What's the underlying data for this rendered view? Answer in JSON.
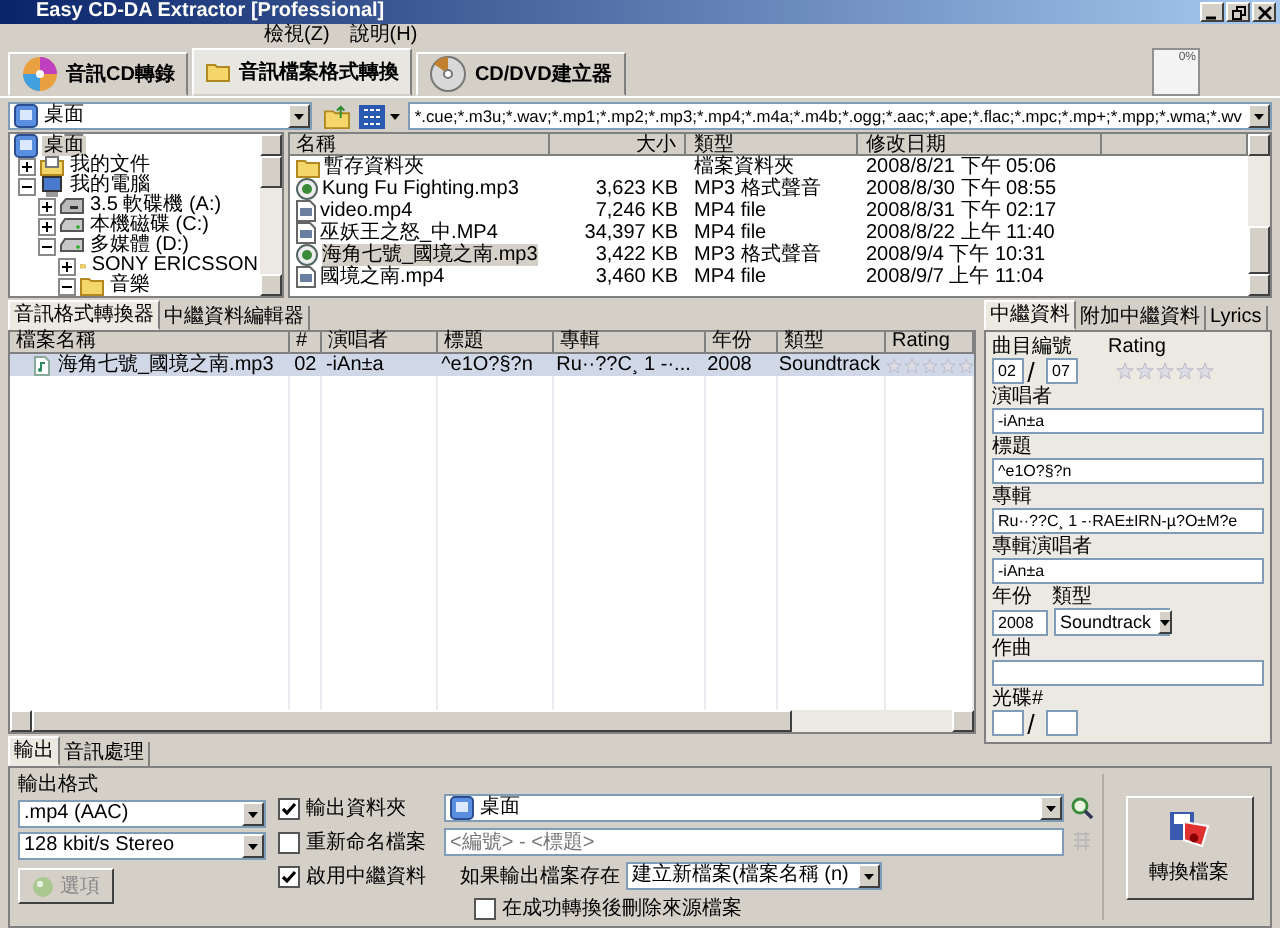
{
  "window": {
    "title": "Easy CD-DA Extractor [Professional]"
  },
  "menu": [
    "檢視(Z)",
    "說明(H)"
  ],
  "main_tabs": [
    {
      "label": "音訊CD轉錄",
      "kind": "cd",
      "selected": false
    },
    {
      "label": "音訊檔案格式轉換",
      "kind": "folder",
      "selected": true
    },
    {
      "label": "CD/DVD建立器",
      "kind": "burn",
      "selected": false
    }
  ],
  "progress": {
    "reading": "0%"
  },
  "location": {
    "value": "桌面"
  },
  "filter": {
    "value": "*.cue;*.m3u;*.wav;*.mp1;*.mp2;*.mp3;*.mp4;*.m4a;*.m4b;*.ogg;*.aac;*.ape;*.flac;*.mpc;*.mp+;*.mpp;*.wma;*.wv"
  },
  "tree_root": {
    "label": "桌面",
    "selected": true
  },
  "folder_tree": [
    {
      "label": "我的文件",
      "kind": "documents",
      "expanded": false,
      "selected": false
    },
    {
      "label": "我的電腦",
      "kind": "computer",
      "expanded": true,
      "selected": false,
      "children": [
        {
          "label": "3.5 軟碟機 (A:)",
          "kind": "floppy",
          "expanded": false,
          "selected": false
        },
        {
          "label": "本機磁碟 (C:)",
          "kind": "drive",
          "expanded": false,
          "selected": false
        },
        {
          "label": "多媒體 (D:)",
          "kind": "drive",
          "expanded": true,
          "selected": false,
          "children": [
            {
              "label": "SONY ERICSSON",
              "kind": "folder",
              "expanded": false,
              "selected": false
            },
            {
              "label": "音樂",
              "kind": "folder",
              "expanded": true,
              "selected": false
            }
          ]
        }
      ]
    }
  ],
  "file_list": {
    "columns": [
      "名稱",
      "大小",
      "類型",
      "修改日期"
    ],
    "rows": [
      {
        "name": "暫存資料夾",
        "type": "檔案資料夾",
        "modified": "2008/8/21 下午 05:06",
        "kind": "folder",
        "selected": false
      },
      {
        "name": "Kung Fu Fighting.mp3",
        "size": "3,623 KB",
        "type": "MP3 格式聲音",
        "modified": "2008/8/30 下午 08:55",
        "kind": "audio",
        "selected": false
      },
      {
        "name": "video.mp4",
        "size": "7,246 KB",
        "type": "MP4 file",
        "modified": "2008/8/31 下午 02:17",
        "kind": "video",
        "selected": false
      },
      {
        "name": "巫妖王之怒_中.MP4",
        "size": "34,397 KB",
        "type": "MP4 file",
        "modified": "2008/8/22 上午 11:40",
        "kind": "video",
        "selected": false
      },
      {
        "name": "海角七號_國境之南.mp3",
        "size": "3,422 KB",
        "type": "MP3 格式聲音",
        "modified": "2008/9/4 下午 10:31",
        "kind": "audio",
        "selected": true
      },
      {
        "name": "國境之南.mp4",
        "size": "3,460 KB",
        "type": "MP4 file",
        "modified": "2008/9/7 上午 11:04",
        "kind": "video",
        "selected": false
      }
    ]
  },
  "converter_tabs": [
    {
      "label": "音訊格式轉換器",
      "selected": true
    },
    {
      "label": "中繼資料編輯器",
      "selected": false
    }
  ],
  "queue": {
    "columns": [
      "檔案名稱",
      "#",
      "演唱者",
      "標題",
      "專輯",
      "年份",
      "類型",
      "Rating"
    ],
    "rows": [
      {
        "file": "海角七號_國境之南.mp3",
        "track": "02",
        "artist": "-iAn±a",
        "title": "^e1O?§?n",
        "album": "Ru··??C¸ 1 -·...",
        "year": "2008",
        "genre": "Soundtrack",
        "stars": 0,
        "selected": true
      }
    ]
  },
  "tag_tabs": [
    {
      "label": "中繼資料",
      "selected": true
    },
    {
      "label": "附加中繼資料",
      "selected": false
    },
    {
      "label": "Lyrics",
      "selected": false
    }
  ],
  "tags": {
    "track_label": "曲目編號",
    "track": "02",
    "track_total": "07",
    "rating_label": "Rating",
    "stars": 0,
    "fields": [
      {
        "label": "演唱者",
        "value": "-iAn±a"
      },
      {
        "label": "標題",
        "value": "^e1O?§?n"
      },
      {
        "label": "專輯",
        "value": "Ru··??C¸ 1 -·RAE±IRN-µ?O±M?e"
      },
      {
        "label": "專輯演唱者",
        "value": "-iAn±a"
      }
    ],
    "year_label": "年份",
    "year": "2008",
    "genre_label": "類型",
    "genre": "Soundtrack",
    "composer_label": "作曲",
    "disc_label": "光碟#"
  },
  "output_tabs": [
    {
      "label": "輸出",
      "selected": true
    },
    {
      "label": "音訊處理",
      "selected": false
    }
  ],
  "output": {
    "format_label": "輸出格式",
    "format": ".mp4 (AAC)",
    "quality": "128 kbit/s Stereo",
    "options_button": {
      "label": "選項",
      "disabled": true
    },
    "output_folder": {
      "label": "輸出資料夾",
      "checked": true,
      "value": "桌面"
    },
    "rename": {
      "label": "重新命名檔案",
      "checked": false,
      "placeholder": "<編號> - <標題>"
    },
    "metadata": {
      "label": "啟用中繼資料",
      "checked": true
    },
    "if_exists_label": "如果輸出檔案存在",
    "if_exists": "建立新檔案(檔案名稱 (n)",
    "delete_source": {
      "label": "在成功轉換後刪除來源檔案",
      "checked": false
    },
    "convert_button": "轉換檔案"
  }
}
